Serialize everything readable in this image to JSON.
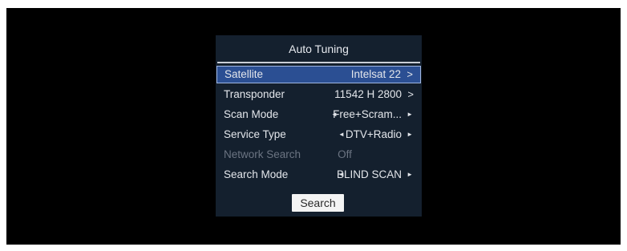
{
  "panel": {
    "title": "Auto Tuning",
    "rows": [
      {
        "label": "Satellite",
        "value": "Intelsat 22",
        "control": "chevron-right",
        "selected": true,
        "disabled": false
      },
      {
        "label": "Transponder",
        "value": "11542 H 2800",
        "control": "chevron-right",
        "selected": false,
        "disabled": false
      },
      {
        "label": "Scan Mode",
        "value": "Free+Scram...",
        "control": "left-right-triangles",
        "selected": false,
        "disabled": false
      },
      {
        "label": "Service Type",
        "value": "DTV+Radio",
        "control": "left-right-triangles",
        "selected": false,
        "disabled": false
      },
      {
        "label": "Network Search",
        "value": "Off",
        "control": "none",
        "selected": false,
        "disabled": true
      },
      {
        "label": "Search Mode",
        "value": "BLIND SCAN",
        "control": "left-right-triangles",
        "selected": false,
        "disabled": false
      }
    ],
    "search_label": "Search"
  },
  "glyphs": {
    "chevron_right": ">",
    "tri_left": "◄",
    "tri_right": "►"
  },
  "colors": {
    "panel_bg": "#14202e",
    "selected_bg": "#2b4f93",
    "disabled_text": "#6b7482"
  }
}
